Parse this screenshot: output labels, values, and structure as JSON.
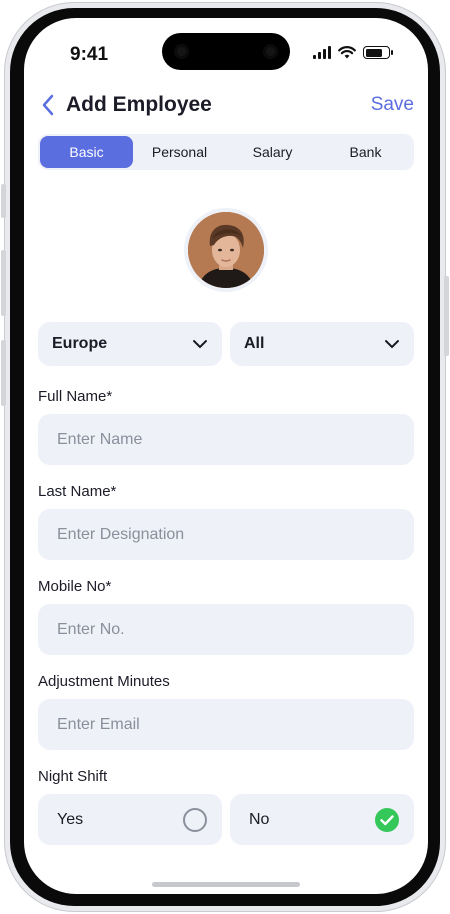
{
  "status_bar": {
    "time": "9:41"
  },
  "header": {
    "title": "Add Employee",
    "save_label": "Save"
  },
  "tabs": [
    {
      "label": "Basic",
      "active": true
    },
    {
      "label": "Personal",
      "active": false
    },
    {
      "label": "Salary",
      "active": false
    },
    {
      "label": "Bank",
      "active": false
    }
  ],
  "filters": {
    "region": "Europe",
    "category": "All"
  },
  "fields": {
    "full_name": {
      "label": "Full Name*",
      "placeholder": "Enter Name",
      "value": ""
    },
    "last_name": {
      "label": "Last Name*",
      "placeholder": "Enter Designation",
      "value": ""
    },
    "mobile": {
      "label": "Mobile No*",
      "placeholder": "Enter No.",
      "value": ""
    },
    "adjustment": {
      "label": "Adjustment Minutes",
      "placeholder": "Enter Email",
      "value": ""
    }
  },
  "night_shift": {
    "label": "Night Shift",
    "options": [
      {
        "label": "Yes",
        "selected": false
      },
      {
        "label": "No",
        "selected": true
      }
    ]
  },
  "colors": {
    "accent": "#5b6ee0",
    "input_bg": "#eef1f7",
    "success": "#34c759",
    "text": "#1c1c28",
    "placeholder": "#8a8f9c"
  },
  "icons": {
    "back": "chevron-left-icon",
    "dropdown": "chevron-down-icon",
    "unselected": "radio-empty-icon",
    "selected": "check-circle-icon"
  }
}
